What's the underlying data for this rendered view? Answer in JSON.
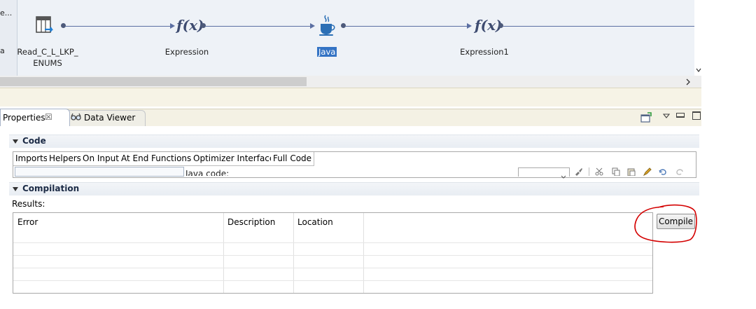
{
  "canvas": {
    "left_truncated": [
      "e...",
      "a"
    ],
    "nodes": [
      {
        "label_line1": "Read_C_L_LKP_",
        "label_line2": "ENUMS",
        "icon": "read-source-icon"
      },
      {
        "label_line1": "Expression",
        "icon": "expression-fx-icon"
      },
      {
        "label_line1": "Java",
        "icon": "java-coffee-icon",
        "selected": true
      },
      {
        "label_line1": "Expression1",
        "icon": "expression-fx-icon"
      }
    ],
    "fx_glyph": "f(x)"
  },
  "views": {
    "tabs": [
      {
        "label": "Properties",
        "active": true,
        "close": "☒"
      },
      {
        "label": "Data Viewer",
        "active": false
      }
    ]
  },
  "code_section": {
    "title": "Code",
    "tabs": [
      "Imports",
      "Helpers",
      "On Input",
      "At End",
      "Functions",
      "Optimizer Interfaces",
      "Full Code"
    ],
    "java_code_label": "Java code:"
  },
  "compilation_section": {
    "title": "Compilation",
    "results_label": "Results:",
    "columns": [
      "Error",
      "Description",
      "Location"
    ],
    "compile_label": "Compile",
    "annotation_color": "#d40000"
  },
  "colors": {
    "selection": "#3373c4",
    "canvas_bg": "#eef2f7"
  }
}
